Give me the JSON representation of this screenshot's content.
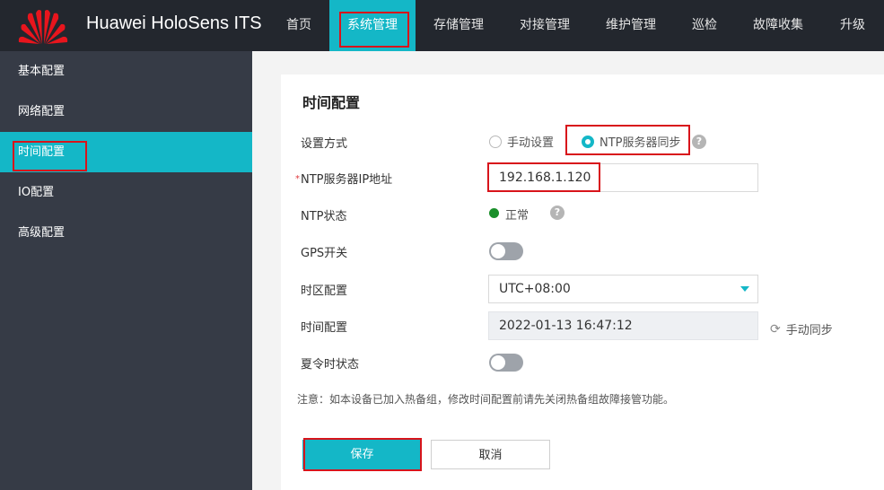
{
  "app": {
    "title": "Huawei HoloSens ITS"
  },
  "nav": [
    {
      "label": "首页"
    },
    {
      "label": "系统管理"
    },
    {
      "label": "存储管理"
    },
    {
      "label": "对接管理"
    },
    {
      "label": "维护管理"
    },
    {
      "label": "巡检"
    },
    {
      "label": "故障收集"
    },
    {
      "label": "升级"
    }
  ],
  "sidebar": [
    {
      "label": "基本配置"
    },
    {
      "label": "网络配置"
    },
    {
      "label": "时间配置"
    },
    {
      "label": "IO配置"
    },
    {
      "label": "高级配置"
    }
  ],
  "form": {
    "title": "时间配置",
    "mode": {
      "label": "设置方式",
      "options": [
        {
          "label": "手动设置",
          "checked": false
        },
        {
          "label": "NTP服务器同步",
          "checked": true
        }
      ],
      "help_icon": "question-icon"
    },
    "ntp_ip": {
      "required_mark": "*",
      "label": "NTP服务器IP地址",
      "value": "192.168.1.120"
    },
    "ntp_status": {
      "label": "NTP状态",
      "value": "正常",
      "status_color": "#1a8f2a"
    },
    "gps": {
      "label": "GPS开关",
      "enabled": false
    },
    "timezone": {
      "label": "时区配置",
      "value": "UTC+08:00"
    },
    "time": {
      "label": "时间配置",
      "value": "2022-01-13 16:47:12",
      "sync_label": "手动同步"
    },
    "dst": {
      "label": "夏令时状态",
      "enabled": false
    },
    "note": "注意：如本设备已加入热备组，修改时间配置前请先关闭热备组故障接管功能。"
  },
  "buttons": {
    "save": "保存",
    "cancel": "取消"
  },
  "colors": {
    "accent": "#14b7c7",
    "highlight": "#d8141b",
    "topbar": "#23272e",
    "sidebar": "#363b46"
  }
}
